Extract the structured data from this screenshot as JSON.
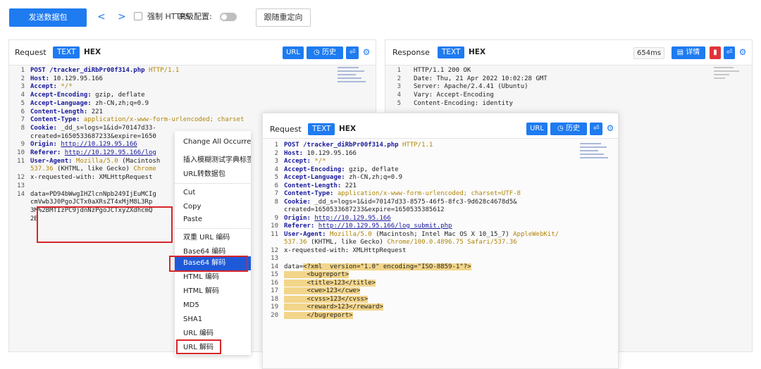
{
  "toolbar": {
    "send_label": "发送数据包",
    "back": "<",
    "forward": ">",
    "force_https_label": "强制 HTTPS",
    "advanced_label": "高级配置:",
    "follow_redirect_label": "跟随重定向"
  },
  "request_panel": {
    "title": "Request",
    "tab_text": "TEXT",
    "tab_hex": "HEX",
    "url_btn": "URL",
    "history_btn": "历史",
    "lines": [
      {
        "n": "1",
        "parts": [
          [
            "k",
            "POST /tracker_diRbPr00f314.php "
          ],
          [
            "o",
            "HTTP/1.1"
          ]
        ]
      },
      {
        "n": "2",
        "parts": [
          [
            "k",
            "Host: "
          ],
          [
            "v",
            "10.129.95.166"
          ]
        ]
      },
      {
        "n": "3",
        "parts": [
          [
            "k",
            "Accept: "
          ],
          [
            "o",
            "*/*"
          ]
        ]
      },
      {
        "n": "4",
        "parts": [
          [
            "k",
            "Accept-Encoding: "
          ],
          [
            "v",
            "gzip, deflate"
          ]
        ]
      },
      {
        "n": "5",
        "parts": [
          [
            "k",
            "Accept-Language: "
          ],
          [
            "v",
            "zh-CN,zh;q=0.9"
          ]
        ]
      },
      {
        "n": "6",
        "parts": [
          [
            "k",
            "Content-Length: "
          ],
          [
            "v",
            "221"
          ]
        ]
      },
      {
        "n": "7",
        "parts": [
          [
            "k",
            "Content-Type: "
          ],
          [
            "o",
            "application/x-www-form-urlencoded; charset"
          ]
        ]
      },
      {
        "n": "8",
        "parts": [
          [
            "k",
            "Cookie: "
          ],
          [
            "v",
            "_dd_s=logs=1&id=70147d33-"
          ]
        ]
      },
      {
        "n": "",
        "parts": [
          [
            "v",
            "created=1650533687233&expire=1650"
          ]
        ]
      },
      {
        "n": "9",
        "parts": [
          [
            "k",
            "Origin: "
          ],
          [
            "u",
            "http://10.129.95.166"
          ]
        ]
      },
      {
        "n": "10",
        "parts": [
          [
            "k",
            "Referer: "
          ],
          [
            "u",
            "http://10.129.95.166/log"
          ]
        ]
      },
      {
        "n": "11",
        "parts": [
          [
            "k",
            "User-Agent: "
          ],
          [
            "o",
            "Mozilla/5.0 "
          ],
          [
            "v",
            "(Macintosh"
          ]
        ]
      },
      {
        "n": "",
        "parts": [
          [
            "o",
            "537.36 "
          ],
          [
            "v",
            "(KHTML, like Gecko) "
          ],
          [
            "o",
            "Chrome"
          ]
        ]
      },
      {
        "n": "12",
        "parts": [
          [
            "v",
            "x-requested-with: XMLHttpRequest"
          ]
        ]
      },
      {
        "n": "13",
        "parts": [
          [
            "v",
            ""
          ]
        ]
      },
      {
        "n": "14",
        "parts": [
          [
            "v",
            "data=PD94bWwgIHZlcnNpb249IjEuMCIg"
          ]
        ]
      },
      {
        "n": "",
        "parts": [
          [
            "v",
            "cmVwb3J0PgoJCTx0aXRsZT4xMjM8L3Rp"
          ]
        ]
      },
      {
        "n": "",
        "parts": [
          [
            "v",
            "3M%2BMTIzPC9jdnNzPgoJCTxyZXdhcmQ"
          ]
        ]
      },
      {
        "n": "",
        "parts": [
          [
            "v",
            "2B"
          ]
        ]
      }
    ]
  },
  "response_panel": {
    "title": "Response",
    "tab_text": "TEXT",
    "tab_hex": "HEX",
    "time": "654ms",
    "detail_btn": "详情",
    "lines": [
      {
        "n": "1",
        "text": "HTTP/1.1 200 OK"
      },
      {
        "n": "2",
        "text": "Date: Thu, 21 Apr 2022 10:02:28 GMT"
      },
      {
        "n": "3",
        "text": "Server: Apache/2.4.41 (Ubuntu)"
      },
      {
        "n": "4",
        "text": "Vary: Accept-Encoding"
      },
      {
        "n": "5",
        "text": "Content-Encoding: identity"
      }
    ]
  },
  "context_menu": {
    "items": [
      {
        "label": "Change All Occurrences",
        "y": 0
      },
      {
        "label": "插入模糊测试字典标签",
        "y": 1
      },
      {
        "label": "URL转数据包",
        "y": 2
      },
      {
        "label": "Cut",
        "y": 3
      },
      {
        "label": "Copy",
        "y": 4
      },
      {
        "label": "Paste",
        "y": 5
      },
      {
        "label": "双重 URL 编码",
        "y": 6
      },
      {
        "label": "Base64 编码",
        "y": 7
      },
      {
        "label": "Base64 解码",
        "y": 8
      },
      {
        "label": "HTML 编码",
        "y": 9
      },
      {
        "label": "HTML 解码",
        "y": 10
      },
      {
        "label": "MD5",
        "y": 11
      },
      {
        "label": "SHA1",
        "y": 12
      },
      {
        "label": "URL 编码",
        "y": 13
      },
      {
        "label": "URL 解码",
        "y": 14
      }
    ],
    "active_label": "Base64 解码"
  },
  "decoded_panel": {
    "title": "Request",
    "tab_text": "TEXT",
    "tab_hex": "HEX",
    "url_btn": "URL",
    "history_btn": "历史",
    "lines": [
      {
        "n": "1",
        "parts": [
          [
            "k",
            "POST /tracker_diRbPr00f314.php "
          ],
          [
            "o",
            "HTTP/1.1"
          ]
        ]
      },
      {
        "n": "2",
        "parts": [
          [
            "k",
            "Host: "
          ],
          [
            "v",
            "10.129.95.166"
          ]
        ]
      },
      {
        "n": "3",
        "parts": [
          [
            "k",
            "Accept: "
          ],
          [
            "o",
            "*/*"
          ]
        ]
      },
      {
        "n": "4",
        "parts": [
          [
            "k",
            "Accept-Encoding: "
          ],
          [
            "v",
            "gzip, deflate"
          ]
        ]
      },
      {
        "n": "5",
        "parts": [
          [
            "k",
            "Accept-Language: "
          ],
          [
            "v",
            "zh-CN,zh;q=0.9"
          ]
        ]
      },
      {
        "n": "6",
        "parts": [
          [
            "k",
            "Content-Length: "
          ],
          [
            "v",
            "221"
          ]
        ]
      },
      {
        "n": "7",
        "parts": [
          [
            "k",
            "Content-Type: "
          ],
          [
            "o",
            "application/x-www-form-urlencoded; charset=UTF-8"
          ]
        ]
      },
      {
        "n": "8",
        "parts": [
          [
            "k",
            "Cookie: "
          ],
          [
            "v",
            "_dd_s=logs=1&id=70147d33-8575-46f5-8fc3-9d628c4678d5&"
          ]
        ]
      },
      {
        "n": "",
        "parts": [
          [
            "v",
            "created=1650533687233&expire=1650535385612"
          ]
        ]
      },
      {
        "n": "9",
        "parts": [
          [
            "k",
            "Origin: "
          ],
          [
            "u",
            "http://10.129.95.166"
          ]
        ]
      },
      {
        "n": "10",
        "parts": [
          [
            "k",
            "Referer: "
          ],
          [
            "u",
            "http://10.129.95.166/log_submit.php"
          ]
        ]
      },
      {
        "n": "11",
        "parts": [
          [
            "k",
            "User-Agent: "
          ],
          [
            "o",
            "Mozilla/5.0 "
          ],
          [
            "v",
            "(Macintosh; Intel Mac OS X 10_15_7) "
          ],
          [
            "o",
            "AppleWebKit/"
          ]
        ]
      },
      {
        "n": "",
        "parts": [
          [
            "o",
            "537.36 "
          ],
          [
            "v",
            "(KHTML, like Gecko) "
          ],
          [
            "o",
            "Chrome/100.0.4896.75 Safari/537.36"
          ]
        ]
      },
      {
        "n": "12",
        "parts": [
          [
            "v",
            "x-requested-with: XMLHttpRequest"
          ]
        ]
      },
      {
        "n": "13",
        "parts": [
          [
            "v",
            ""
          ]
        ]
      },
      {
        "n": "14",
        "parts": [
          [
            "v",
            "data="
          ],
          [
            "h",
            "<?xml  version=\"1.0\" encoding=\"ISO-8859-1\"?>"
          ]
        ]
      },
      {
        "n": "15",
        "parts": [
          [
            "h",
            "      <bugreport>"
          ]
        ]
      },
      {
        "n": "16",
        "parts": [
          [
            "h",
            "      <title>123</title>"
          ]
        ]
      },
      {
        "n": "17",
        "parts": [
          [
            "h",
            "      <cwe>123</cwe>"
          ]
        ]
      },
      {
        "n": "18",
        "parts": [
          [
            "h",
            "      <cvss>123</cvss>"
          ]
        ]
      },
      {
        "n": "19",
        "parts": [
          [
            "h",
            "      <reward>123</reward>"
          ]
        ]
      },
      {
        "n": "20",
        "parts": [
          [
            "h",
            "      </bugreport>"
          ]
        ]
      }
    ]
  }
}
